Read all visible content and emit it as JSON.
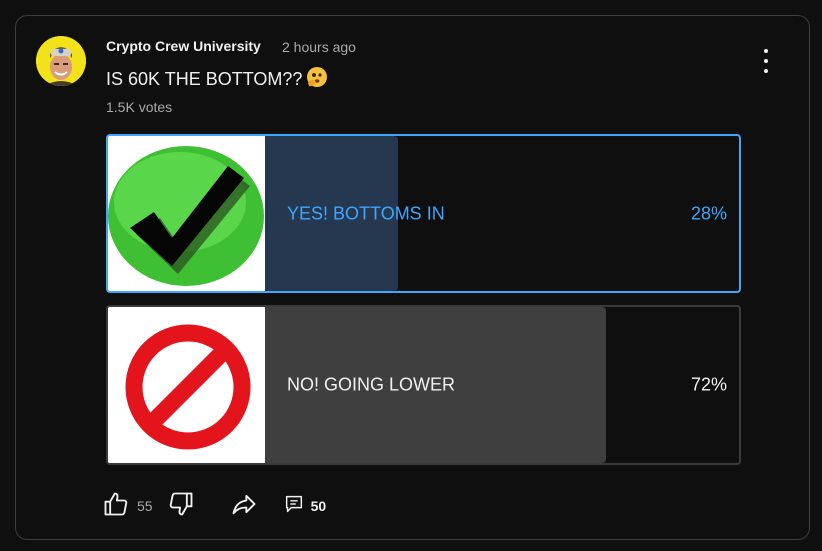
{
  "post": {
    "channel_name": "Crypto Crew University",
    "time_ago": "2 hours ago",
    "title": "IS 60K THE BOTTOM??",
    "title_emoji": "🫣",
    "votes": "1.5K votes"
  },
  "poll": {
    "options": [
      {
        "label": "YES! BOTTOMS IN",
        "percent": "28%",
        "fill_fraction": 0.28,
        "selected": true,
        "icon": "green-checkmark-icon"
      },
      {
        "label": "NO! GOING LOWER",
        "percent": "72%",
        "fill_fraction": 0.72,
        "selected": false,
        "icon": "red-prohibition-icon"
      }
    ]
  },
  "actions": {
    "like_count": "55",
    "comment_count": "50",
    "like_icon": "thumbs-up-icon",
    "dislike_icon": "thumbs-down-icon",
    "share_icon": "share-icon",
    "comment_icon": "comment-icon"
  },
  "colors": {
    "selected_accent": "#3ea6ff",
    "selected_fill": "#263850",
    "unselected_fill": "#3f3f3f",
    "background": "#0f0f0f"
  }
}
